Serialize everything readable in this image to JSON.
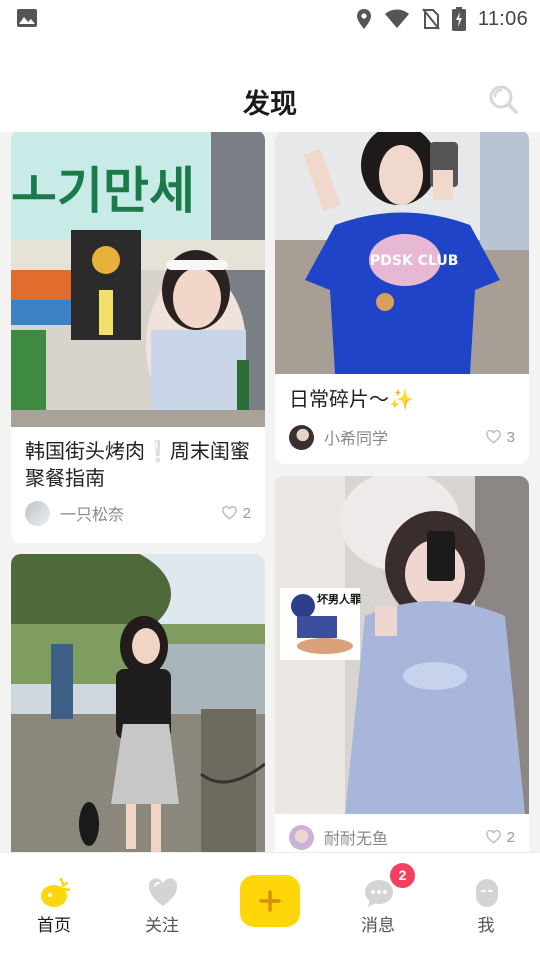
{
  "status_bar": {
    "time": "11:06",
    "icons": [
      "gallery-icon",
      "location-icon",
      "wifi-icon",
      "no-sim-icon",
      "battery-charging-icon"
    ]
  },
  "header": {
    "title": "发现",
    "search_icon": "search-icon"
  },
  "feed": {
    "left_column": [
      {
        "caption_before": "韩国街头烤肉",
        "caption_emoji": "❕",
        "caption_after": "周末闺蜜聚餐指南",
        "author": "一只松奈",
        "likes": "2",
        "image_sign_text": "ㅗ기만세"
      },
      {
        "caption_before": "",
        "author": "",
        "likes": ""
      }
    ],
    "right_column": [
      {
        "caption_before": "日常碎片～",
        "caption_emoji": "✨",
        "author": "小希同学",
        "likes": "3",
        "shirt_text": "PDSK CLUB"
      },
      {
        "caption_before": "",
        "sticker_text": "坏男人罪",
        "author": "耐耐无鱼",
        "likes": "2"
      }
    ]
  },
  "tabbar": {
    "tabs": [
      {
        "label": "首页",
        "icon": "home-icon",
        "active": true
      },
      {
        "label": "关注",
        "icon": "heart-icon",
        "active": false
      },
      {
        "label": "",
        "icon": "plus-icon",
        "active": false
      },
      {
        "label": "消息",
        "icon": "chat-icon",
        "active": false,
        "badge": "2"
      },
      {
        "label": "我",
        "icon": "profile-icon",
        "active": false
      }
    ]
  },
  "colors": {
    "accent": "#ffd60a",
    "badge": "#f43f5e",
    "like_icon": "#bbbbbb"
  }
}
